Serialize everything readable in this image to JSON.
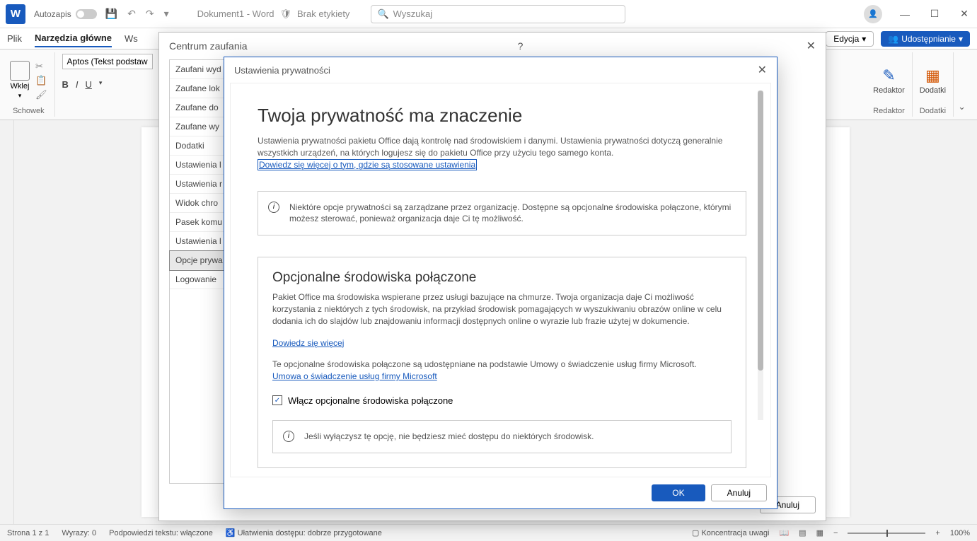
{
  "titlebar": {
    "autosave": "Autozapis",
    "doc_name": "Dokument1 - Word",
    "no_label": "Brak etykiety",
    "search_placeholder": "Wyszukaj"
  },
  "tabs": {
    "file": "Plik",
    "home": "Narzędzia główne",
    "insert_prefix": "Ws"
  },
  "top_right": {
    "edit": "Edycja",
    "share": "Udostępnianie"
  },
  "ribbon": {
    "paste": "Wklej",
    "clipboard": "Schowek",
    "font_name": "Aptos (Tekst podstaw",
    "bold": "B",
    "italic": "I",
    "underline": "U",
    "editor": "Redaktor",
    "addins": "Dodatki",
    "editor_group": "Redaktor",
    "addins_group": "Dodatki"
  },
  "statusbar": {
    "page": "Strona 1 z 1",
    "words": "Wyrazy: 0",
    "subtitles": "Podpowiedzi tekstu: włączone",
    "accessibility": "Ułatwienia dostępu: dobrze przygotowane",
    "focus": "Koncentracja uwagi",
    "zoom": "100%"
  },
  "trust_dialog": {
    "title": "Centrum zaufania",
    "sidebar": [
      "Zaufani wyd",
      "Zaufane lok",
      "Zaufane do",
      "Zaufane wy",
      "Dodatki",
      "Ustawienia l",
      "Ustawienia r",
      "Widok chro",
      "Pasek komu",
      "Ustawienia l",
      "Opcje prywa",
      "Logowanie"
    ],
    "selected_index": 10,
    "cancel": "Anuluj"
  },
  "privacy_dialog": {
    "title": "Ustawienia prywatności",
    "heading": "Twoja prywatność ma znaczenie",
    "para1": "Ustawienia prywatności pakietu Office dają kontrolę nad środowiskiem i danymi. Ustawienia prywatności dotyczą generalnie wszystkich urządzeń, na których logujesz się do pakietu Office przy użyciu tego samego konta.",
    "learn_link": "Dowiedz się więcej o tym, gdzie są stosowane ustawienia",
    "info1": "Niektóre opcje prywatności są zarządzane przez organizację. Dostępne są opcjonalne środowiska połączone, którymi możesz sterować, ponieważ organizacja daje Ci tę możliwość.",
    "section_title": "Opcjonalne środowiska połączone",
    "section_para": "Pakiet Office ma środowiska wspierane przez usługi bazujące na chmurze. Twoja organizacja daje Ci możliwość korzystania z niektórych z tych środowisk, na przykład środowisk pomagających w wyszukiwaniu obrazów online w celu dodania ich do slajdów lub znajdowaniu informacji dostępnych online o wyrazie lub frazie użytej w dokumencie.",
    "learn_more": "Dowiedz się więcej",
    "msa_text": "Te opcjonalne środowiska połączone są udostępniane na podstawie Umowy o świadczenie usług firmy Microsoft.",
    "msa_link": "Umowa o świadczenie usług firmy Microsoft",
    "checkbox_label": "Włącz opcjonalne środowiska połączone",
    "checkbox_checked": true,
    "info2": "Jeśli wyłączysz tę opcję, nie będziesz mieć dostępu do niektórych środowisk.",
    "ok": "OK",
    "cancel": "Anuluj"
  }
}
